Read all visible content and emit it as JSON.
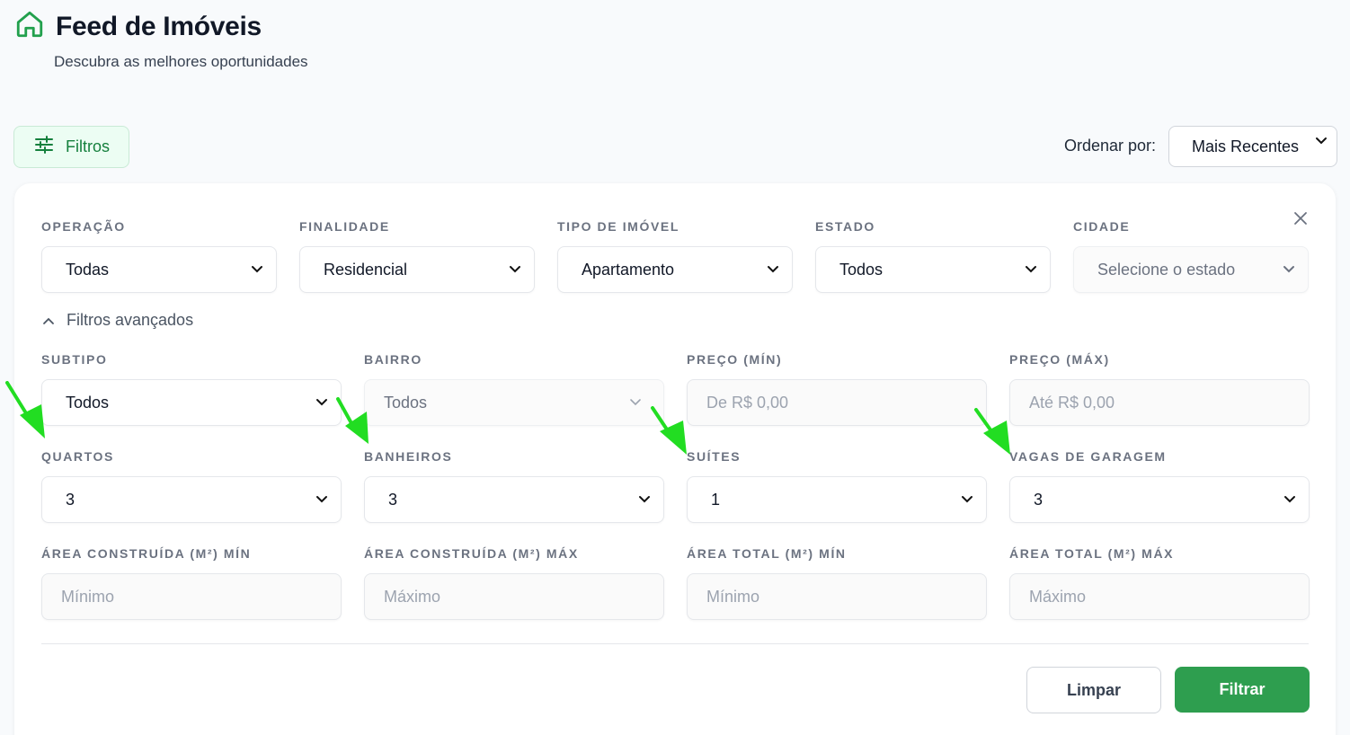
{
  "header": {
    "title": "Feed de Imóveis",
    "subtitle": "Descubra as melhores oportunidades"
  },
  "toolbar": {
    "filters_label": "Filtros",
    "sort_label": "Ordenar por:",
    "sort_value": "Mais Recentes"
  },
  "filters": {
    "operacao": {
      "label": "OPERAÇÃO",
      "value": "Todas"
    },
    "finalidade": {
      "label": "FINALIDADE",
      "value": "Residencial"
    },
    "tipo": {
      "label": "TIPO DE IMÓVEL",
      "value": "Apartamento"
    },
    "estado": {
      "label": "ESTADO",
      "value": "Todos"
    },
    "cidade": {
      "label": "CIDADE",
      "value": "Selecione o estado"
    }
  },
  "advanced": {
    "toggle_label": "Filtros avançados",
    "subtipo": {
      "label": "SUBTIPO",
      "value": "Todos"
    },
    "bairro": {
      "label": "BAIRRO",
      "value": "Todos"
    },
    "preco_min": {
      "label": "PREÇO (MÍN)",
      "placeholder": "De R$ 0,00"
    },
    "preco_max": {
      "label": "PREÇO (MÁX)",
      "placeholder": "Até R$ 0,00"
    },
    "quartos": {
      "label": "QUARTOS",
      "value": "3"
    },
    "banheiros": {
      "label": "BANHEIROS",
      "value": "3"
    },
    "suites": {
      "label": "SUÍTES",
      "value": "1"
    },
    "vagas": {
      "label": "VAGAS DE GARAGEM",
      "value": "3"
    },
    "area_construida_min": {
      "label": "ÁREA CONSTRUÍDA (M²) MÍN",
      "placeholder": "Mínimo"
    },
    "area_construida_max": {
      "label": "ÁREA CONSTRUÍDA (M²) MÁX",
      "placeholder": "Máximo"
    },
    "area_total_min": {
      "label": "ÁREA TOTAL (M²) MÍN",
      "placeholder": "Mínimo"
    },
    "area_total_max": {
      "label": "ÁREA TOTAL (M²) MÁX",
      "placeholder": "Máximo"
    }
  },
  "actions": {
    "clear_label": "Limpar",
    "filter_label": "Filtrar"
  },
  "icons": {
    "home": "home-icon",
    "filters": "sliders-icon",
    "chevron": "chevron-down-icon",
    "close": "close-icon",
    "collapse": "chevron-up-icon",
    "annotation": "green-arrow-icon"
  },
  "colors": {
    "brand": "#2e9e4f",
    "brand_text": "#15803d",
    "annotation_arrow": "#22dd22"
  }
}
